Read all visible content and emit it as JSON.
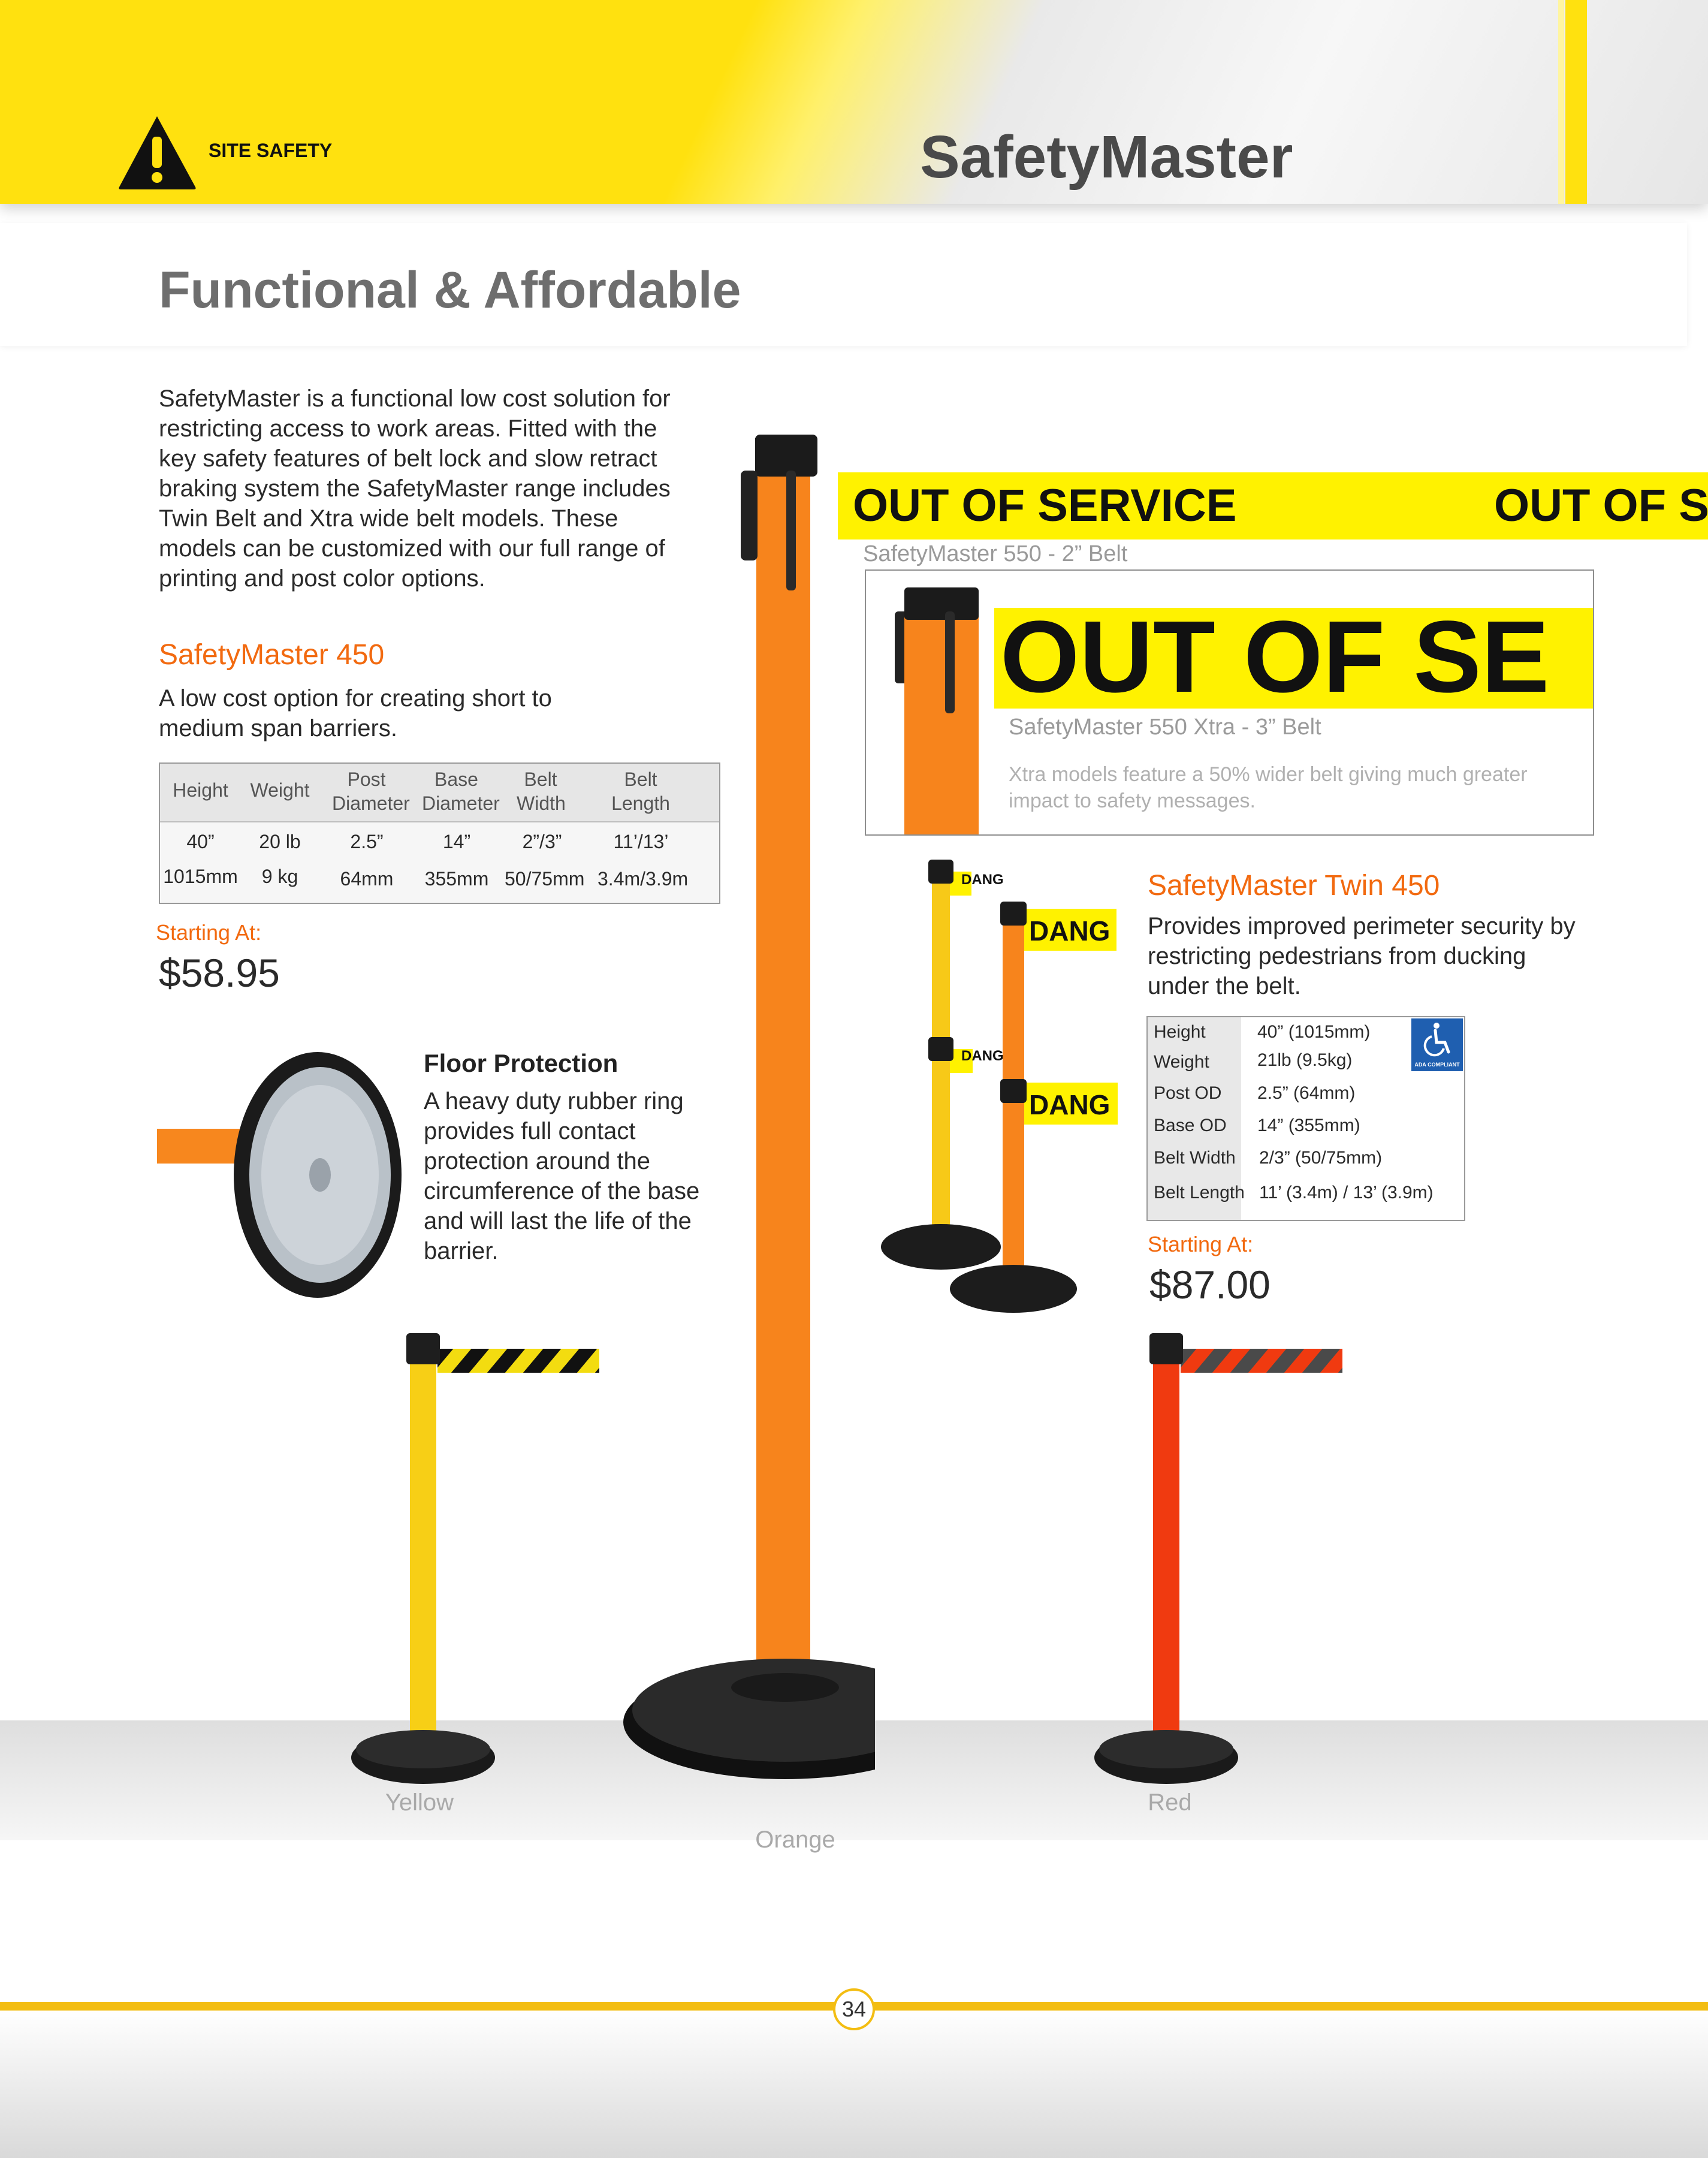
{
  "header": {
    "section_label": "SITE SAFETY",
    "title": "SafetyMaster"
  },
  "intro": {
    "heading": "Functional & Affordable",
    "paragraph": "SafetyMaster is a functional low cost solution for restricting access to work areas. Fitted with the key safety features of belt lock and slow retract braking system the SafetyMaster range includes Twin Belt and Xtra wide belt models. These models can be customized with our full range of printing and post color options."
  },
  "sm450": {
    "title": "SafetyMaster 450",
    "description": "A low cost option for creating short to medium span barriers.",
    "table": {
      "headers": [
        "Height",
        "Weight",
        "Post Diameter",
        "Base Diameter",
        "Belt Width",
        "Belt Length"
      ],
      "rows": [
        [
          "40”",
          "20 lb",
          "2.5”",
          "14”",
          "2”/3”",
          "11’/13’"
        ],
        [
          "1015mm",
          "9 kg",
          "64mm",
          "355mm",
          "50/75mm",
          "3.4m/3.9m"
        ]
      ]
    },
    "starting_label": "Starting At:",
    "price": "$58.95"
  },
  "floor_protection": {
    "title": "Floor Protection",
    "text": "A heavy duty rubber ring provides full contact protection around the circumference of the base and will last the life of the barrier."
  },
  "belt_550": {
    "banner_text": "OUT OF SERVICE",
    "banner_text_2": "OUT OF S",
    "caption": "SafetyMaster 550 - 2” Belt"
  },
  "xtra_box": {
    "banner_text": "OUT OF SE",
    "caption": "SafetyMaster 550 Xtra - 3” Belt",
    "note": "Xtra models feature a 50% wider belt giving much greater impact to safety messages."
  },
  "twin450": {
    "title": "SafetyMaster Twin 450",
    "description": "Provides improved perimeter security by restricting pedestrians from ducking under the belt.",
    "belt_text_small": "DANG",
    "belt_text_large": "DANG",
    "specs": [
      {
        "label": "Height",
        "value": "40” (1015mm)"
      },
      {
        "label": "Weight",
        "value": "21lb (9.5kg)"
      },
      {
        "label": "Post OD",
        "value": "2.5” (64mm)"
      },
      {
        "label": "Base OD",
        "value": "14” (355mm)"
      },
      {
        "label": "Belt Width",
        "value": "2/3” (50/75mm)"
      },
      {
        "label": "Belt Length",
        "value": "11’ (3.4m) / 13’ (3.9m)"
      }
    ],
    "ada_label": "ADA COMPLIANT",
    "starting_label": "Starting At:",
    "price": "$87.00"
  },
  "colors": {
    "yellow_caption": "Yellow",
    "orange_caption": "Orange",
    "red_caption": "Red",
    "accent_orange": "#f26a10",
    "post_yellow": "#ffd21a",
    "post_red": "#f03a10",
    "banner_yellow": "#fff200"
  },
  "footer": {
    "page_number": "34"
  }
}
